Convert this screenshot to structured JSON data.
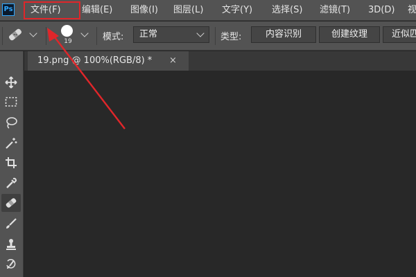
{
  "app": {
    "logo": "Ps"
  },
  "menu": {
    "items": [
      {
        "label": "文件(F)"
      },
      {
        "label": "编辑(E)"
      },
      {
        "label": "图像(I)"
      },
      {
        "label": "图层(L)"
      },
      {
        "label": "文字(Y)"
      },
      {
        "label": "选择(S)"
      },
      {
        "label": "滤镜(T)"
      },
      {
        "label": "3D(D)"
      },
      {
        "label": "视"
      }
    ],
    "highlight_color": "#e0262a"
  },
  "options": {
    "tool_icon": "spot-healing-brush-icon",
    "brush_size": "19",
    "mode_label": "模式:",
    "mode_value": "正常",
    "type_label": "类型:",
    "type_options": [
      "内容识别",
      "创建纹理",
      "近似匹"
    ]
  },
  "tools": [
    {
      "icon": "move-icon"
    },
    {
      "icon": "rectangle-marquee-icon"
    },
    {
      "icon": "lasso-icon"
    },
    {
      "icon": "magic-wand-icon"
    },
    {
      "icon": "crop-icon"
    },
    {
      "icon": "eyedropper-icon"
    },
    {
      "icon": "spot-healing-brush-icon",
      "active": true
    },
    {
      "icon": "brush-icon"
    },
    {
      "icon": "clone-stamp-icon"
    },
    {
      "icon": "history-brush-icon"
    }
  ],
  "document": {
    "tab_title": "19.png @ 100%(RGB/8) *",
    "close_glyph": "×"
  },
  "annotation": {
    "arrow_color": "#e0262a"
  }
}
